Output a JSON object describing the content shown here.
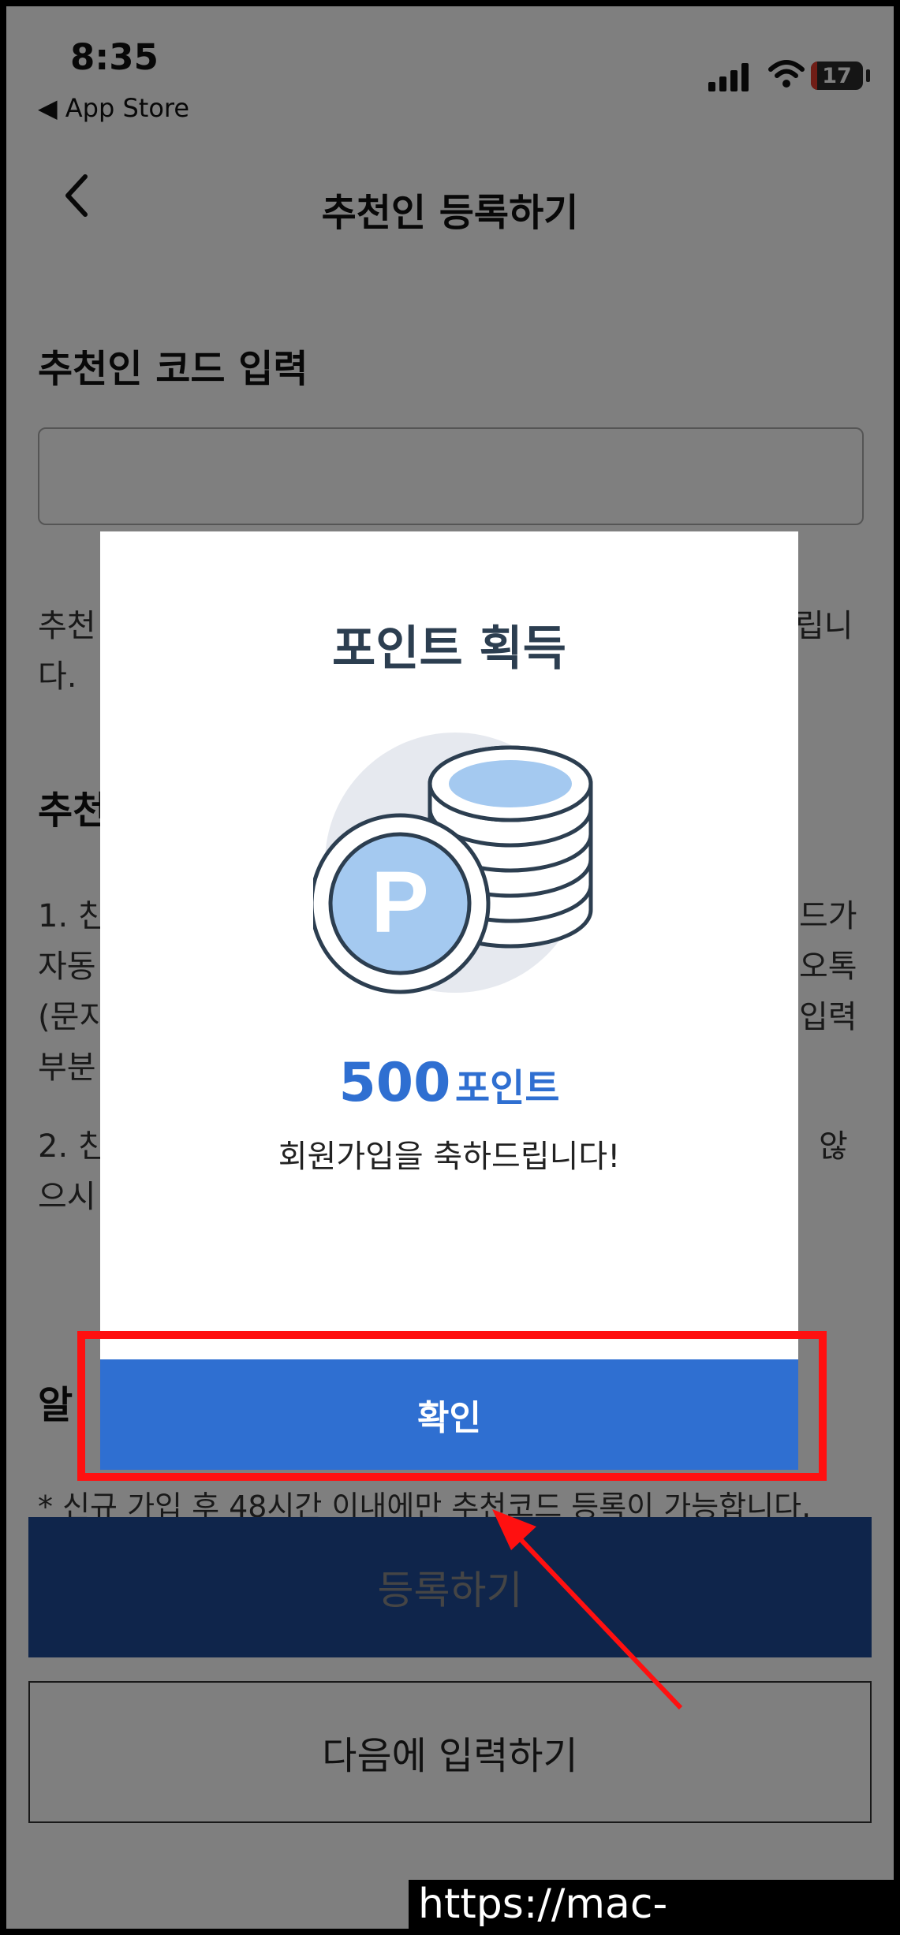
{
  "status_bar": {
    "time": "8:35",
    "back_app": "◀ App Store",
    "battery": "17"
  },
  "header": {
    "title": "추천인 등록하기"
  },
  "content": {
    "code_section_title": "추천인 코드 입력",
    "desc_line1": "추천",
    "desc_line1_end": "립니",
    "desc_line2": "다.",
    "guide_title": "추천",
    "guide_1_a": "1. 친",
    "guide_1_a_end": "드가",
    "guide_1_b": "자동",
    "guide_1_b_end": "오톡",
    "guide_1_c": "(문지",
    "guide_1_c_end": "입력",
    "guide_1_d": "부분",
    "guide_2_a": "2. 친",
    "guide_2_a_end": "않",
    "guide_2_b": "으시",
    "notice_title": "알",
    "notice_text": "* 신규 가입 후 48시간 이내에만 추천코드 등록이 가능합니다."
  },
  "buttons": {
    "register": "등록하기",
    "later": "다음에 입력하기"
  },
  "modal": {
    "title": "포인트 획득",
    "points_amount": "500",
    "points_unit": "포인트",
    "message": "회원가입을 축하드립니다!",
    "confirm": "확인",
    "coin_letter": "P"
  },
  "watermark": "https://mac-os.tistory.com",
  "colors": {
    "primary_blue": "#2f6fd1",
    "navy": "#1e4b96",
    "annotation_red": "#ff1010"
  }
}
